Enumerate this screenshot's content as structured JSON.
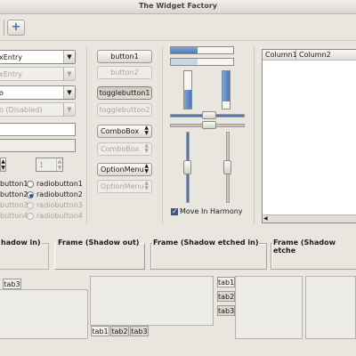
{
  "window": {
    "title": "The Widget Factory"
  },
  "toolbar": {
    "add_icon_glyph": "+"
  },
  "col1": {
    "combo_entry": "xEntry",
    "combo_entry_disabled": "xEntry",
    "combo_value": "o",
    "combo_value_disabled": "o (Disabled)",
    "spin_value": "1"
  },
  "radios": {
    "left": [
      "button1",
      "button2",
      "button3",
      "button4"
    ],
    "right": [
      "radiobutton1",
      "radiobutton2",
      "radiobutton3",
      "radiobutton4"
    ]
  },
  "col2": {
    "button1": "button1",
    "button2": "button2",
    "toggle1": "togglebutton1",
    "toggle2": "togglebutton2",
    "combobox1": "ComboBox",
    "combobox2": "ComboBox",
    "optionmenu1": "OptionMenu",
    "optionmenu2": "OptionMenu"
  },
  "col3": {
    "harmony": "Move In Harmony",
    "hprog1": 0.43,
    "hprog2": 0.43,
    "vprog1": 0.5,
    "vprog2": 0.8
  },
  "tree": {
    "columns": [
      "Column1",
      "Column2"
    ]
  },
  "frames": [
    "hadow in)",
    "Frame (Shadow out)",
    "Frame (Shadow etched in)",
    "Frame (Shadow etche"
  ],
  "notebooks": {
    "nb1": [
      "tab3"
    ],
    "nb2": [
      "tab1",
      "tab2",
      "tab3"
    ],
    "nb3": [
      "tab1",
      "tab2",
      "tab3"
    ]
  }
}
